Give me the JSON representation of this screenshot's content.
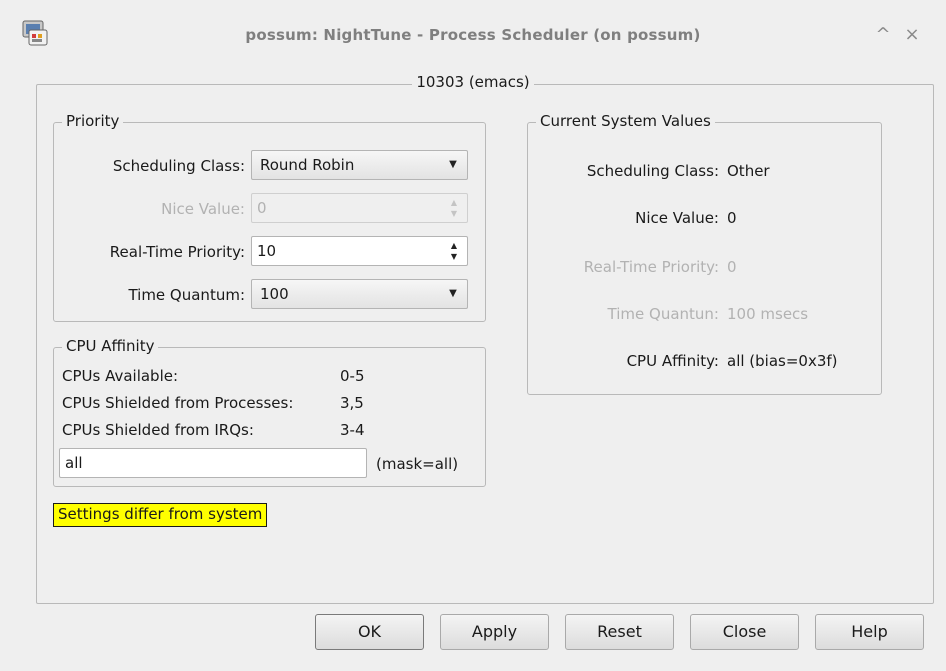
{
  "window": {
    "title": "possum: NightTune - Process Scheduler (on possum)",
    "shade_icon": "^",
    "close_icon": "×"
  },
  "process_frame": {
    "label": "10303 (emacs)"
  },
  "priority": {
    "legend": "Priority",
    "scheduling_class": {
      "label": "Scheduling Class:",
      "value": "Round Robin"
    },
    "nice_value": {
      "label": "Nice Value:",
      "value": "0"
    },
    "rt_priority": {
      "label": "Real-Time Priority:",
      "value": "10"
    },
    "time_quantum": {
      "label": "Time Quantum:",
      "value": "100"
    }
  },
  "cpu_affinity": {
    "legend": "CPU Affinity",
    "rows": [
      {
        "label": "CPUs Available:",
        "value": "0-5"
      },
      {
        "label": "CPUs Shielded from Processes:",
        "value": "3,5"
      },
      {
        "label": "CPUs Shielded from IRQs:",
        "value": "3-4"
      }
    ],
    "input_value": "all",
    "mask": "(mask=all)"
  },
  "warning": {
    "text": "Settings differ from system",
    "color": "#ffff00"
  },
  "current_system": {
    "legend": "Current System Values",
    "scheduling_class": {
      "label": "Scheduling Class:",
      "value": "Other"
    },
    "nice_value": {
      "label": "Nice Value:",
      "value": "0"
    },
    "rt_priority": {
      "label": "Real-Time Priority:",
      "value": "0"
    },
    "time_quantum": {
      "label": "Time Quantun:",
      "value": "100 msecs"
    },
    "cpu_affinity": {
      "label": "CPU Affinity:",
      "value": "all (bias=0x3f)"
    }
  },
  "buttons": {
    "ok": "OK",
    "apply": "Apply",
    "reset": "Reset",
    "close": "Close",
    "help": "Help"
  },
  "icons": {
    "app": "app-icon",
    "shade": "chevron-up-icon",
    "close": "close-icon",
    "combo_arrow": "▼",
    "spin": "▲▼"
  }
}
